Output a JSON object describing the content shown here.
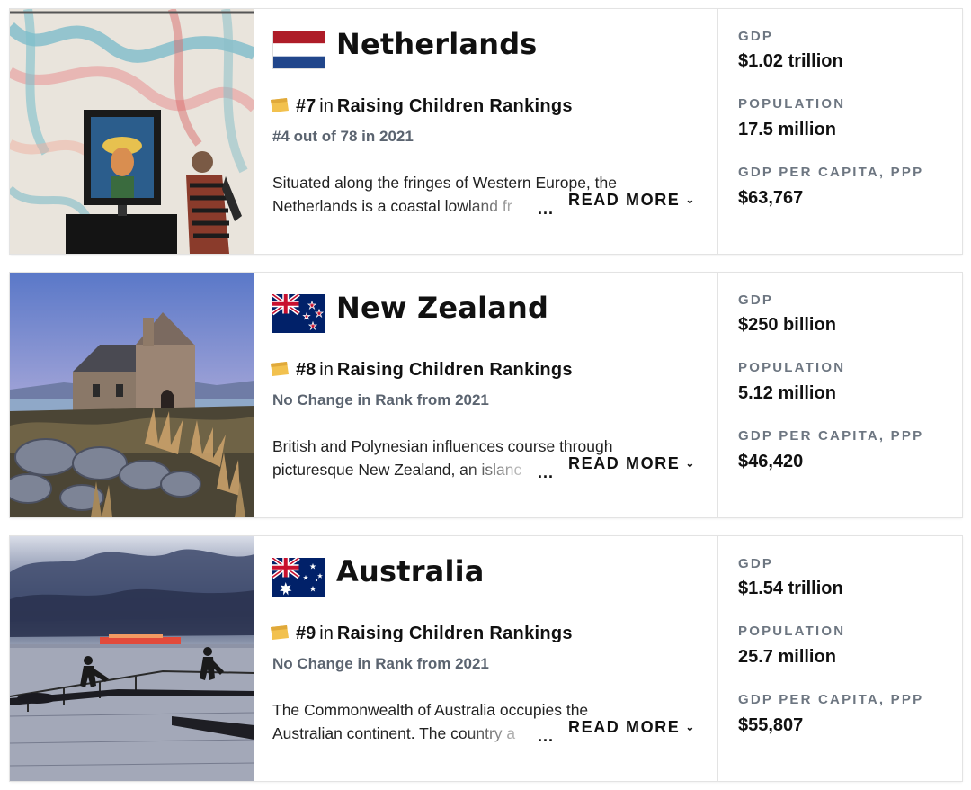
{
  "countries": [
    {
      "name": "Netherlands",
      "rank": "#7",
      "rank_in": "in",
      "ranking_list": "Raising Children Rankings",
      "sub_rank": "#4 out of 78 in 2021",
      "description_line1": "Situated along the fringes of Western Europe, the",
      "description_line2": "Netherlands is a coastal lowland fr",
      "ellipsis": "...",
      "read_more": "READ MORE",
      "flag_icon": "netherlands-flag-icon",
      "image_icon": "museum-van-gogh-photo",
      "stats": [
        {
          "label": "GDP",
          "value": "$1.02 trillion"
        },
        {
          "label": "POPULATION",
          "value": "17.5 million"
        },
        {
          "label": "GDP PER CAPITA, PPP",
          "value": "$63,767"
        }
      ]
    },
    {
      "name": "New Zealand",
      "rank": "#8",
      "rank_in": "in",
      "ranking_list": "Raising Children Rankings",
      "sub_rank": "No Change in Rank from 2021",
      "description_line1": "British and Polynesian influences course through",
      "description_line2": "picturesque New Zealand, an islanc",
      "ellipsis": "...",
      "read_more": "READ MORE",
      "flag_icon": "new-zealand-flag-icon",
      "image_icon": "stone-church-lake-photo",
      "stats": [
        {
          "label": "GDP",
          "value": "$250 billion"
        },
        {
          "label": "POPULATION",
          "value": "5.12 million"
        },
        {
          "label": "GDP PER CAPITA, PPP",
          "value": "$46,420"
        }
      ]
    },
    {
      "name": "Australia",
      "rank": "#9",
      "rank_in": "in",
      "ranking_list": "Raising Children Rankings",
      "sub_rank": "No Change in Rank from 2021",
      "description_line1": "The Commonwealth of Australia occupies the",
      "description_line2": "Australian continent. The country a",
      "ellipsis": "...",
      "read_more": "READ MORE",
      "flag_icon": "australia-flag-icon",
      "image_icon": "surfers-ocean-pool-sunset-photo",
      "stats": [
        {
          "label": "GDP",
          "value": "$1.54 trillion"
        },
        {
          "label": "POPULATION",
          "value": "25.7 million"
        },
        {
          "label": "GDP PER CAPITA, PPP",
          "value": "$55,807"
        }
      ]
    }
  ],
  "colors": {
    "sub_rank": "#5b6470",
    "stat_label": "#6d7681",
    "rank_icon": "#f2c14e"
  }
}
